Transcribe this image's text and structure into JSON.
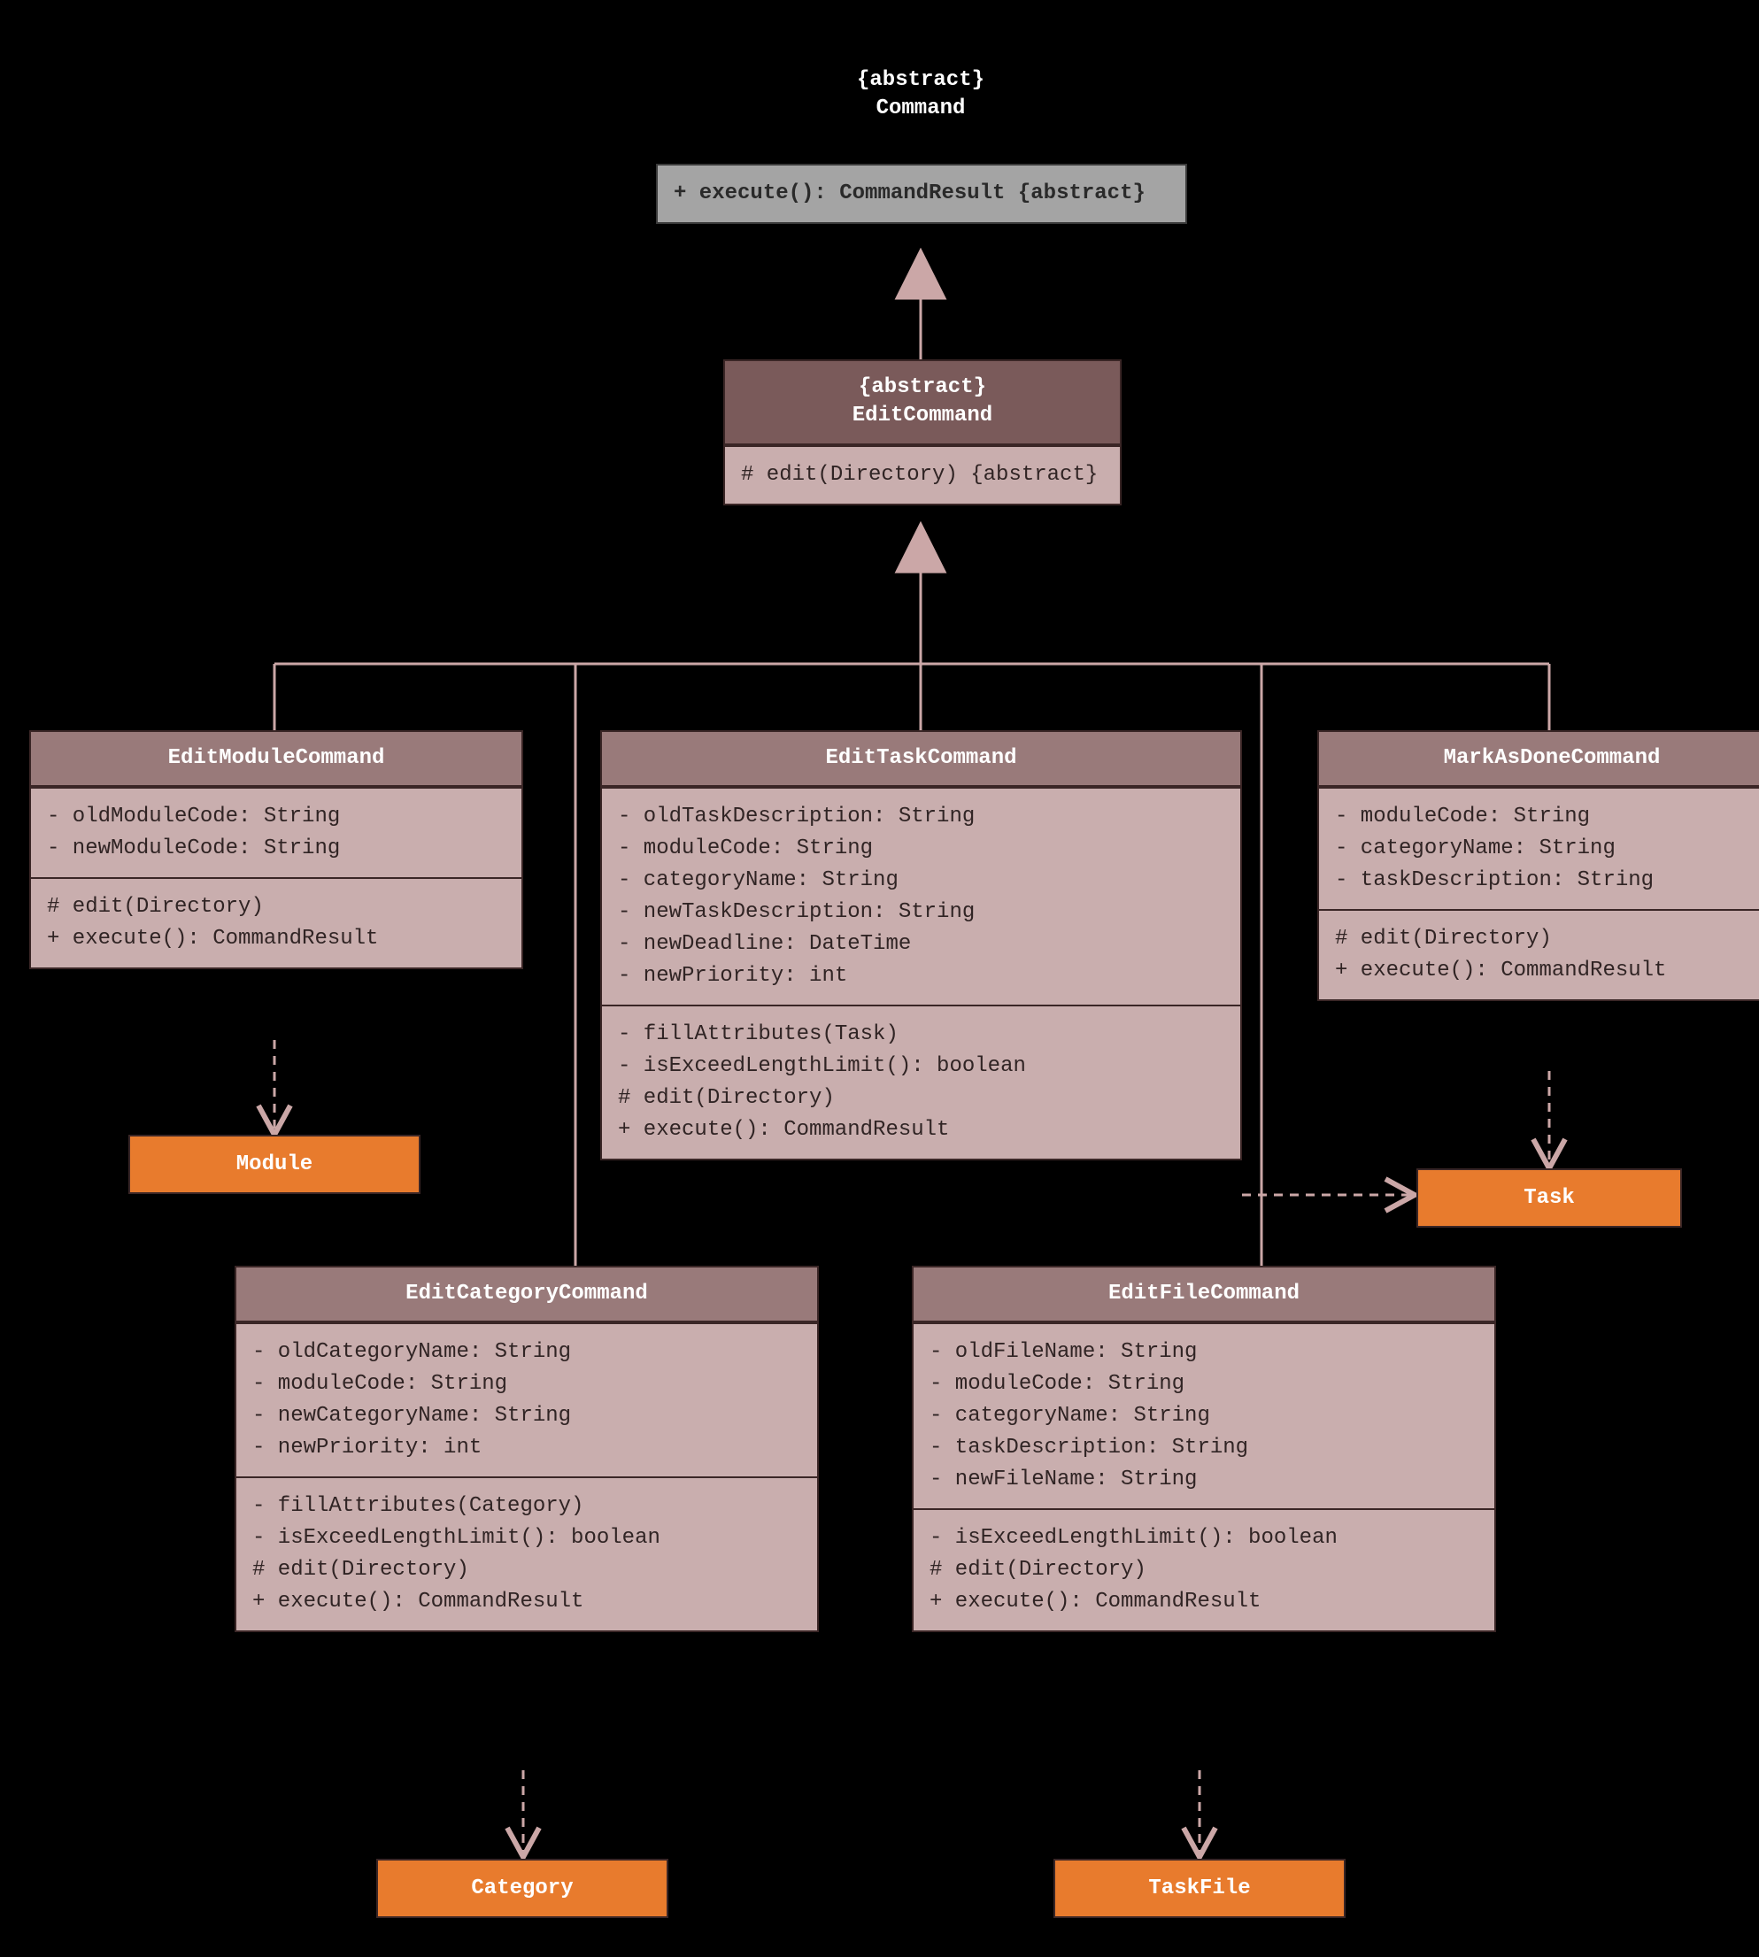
{
  "command": {
    "stereotype": "{abstract}",
    "name": "Command",
    "method": "+ execute(): CommandResult {abstract}"
  },
  "editCommand": {
    "stereotype": "{abstract}",
    "name": "EditCommand",
    "method": "# edit(Directory) {abstract}"
  },
  "editModuleCommand": {
    "name": "EditModuleCommand",
    "attrs": [
      "- oldModuleCode: String",
      "- newModuleCode: String"
    ],
    "methods": [
      "# edit(Directory)",
      "+ execute(): CommandResult"
    ]
  },
  "editTaskCommand": {
    "name": "EditTaskCommand",
    "attrs": [
      "- oldTaskDescription: String",
      "- moduleCode: String",
      "- categoryName: String",
      "- newTaskDescription: String",
      "- newDeadline: DateTime",
      "- newPriority: int"
    ],
    "methods": [
      "- fillAttributes(Task)",
      "- isExceedLengthLimit(): boolean",
      "# edit(Directory)",
      "+ execute(): CommandResult"
    ]
  },
  "markAsDoneCommand": {
    "name": "MarkAsDoneCommand",
    "attrs": [
      "- moduleCode: String",
      "- categoryName: String",
      "- taskDescription: String"
    ],
    "methods": [
      "# edit(Directory)",
      "+ execute(): CommandResult"
    ]
  },
  "editCategoryCommand": {
    "name": "EditCategoryCommand",
    "attrs": [
      "- oldCategoryName: String",
      "- moduleCode: String",
      "- newCategoryName: String",
      "- newPriority: int"
    ],
    "methods": [
      "- fillAttributes(Category)",
      "- isExceedLengthLimit(): boolean",
      "# edit(Directory)",
      "+ execute(): CommandResult"
    ]
  },
  "editFileCommand": {
    "name": "EditFileCommand",
    "attrs": [
      "- oldFileName: String",
      "- moduleCode: String",
      "- categoryName: String",
      "- taskDescription: String",
      "- newFileName: String"
    ],
    "methods": [
      "- isExceedLengthLimit(): boolean",
      "# edit(Directory)",
      "+ execute(): CommandResult"
    ]
  },
  "targets": {
    "module": "Module",
    "task": "Task",
    "category": "Category",
    "taskFile": "TaskFile"
  }
}
